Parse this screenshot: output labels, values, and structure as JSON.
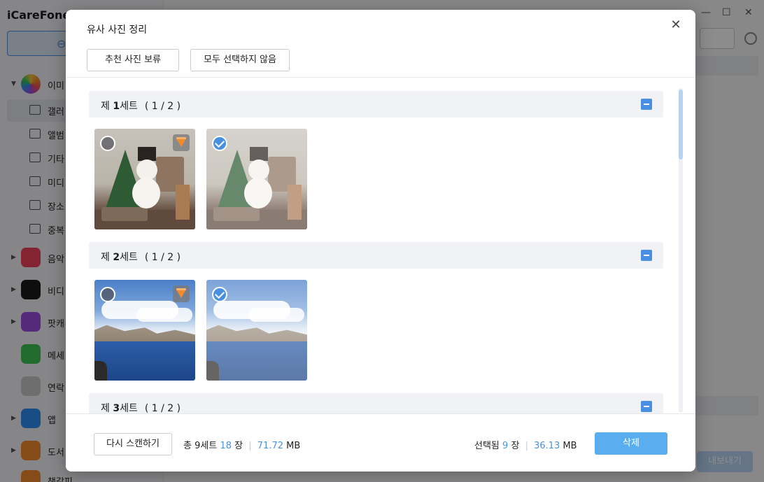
{
  "app": {
    "title": "iCareFone",
    "sidebar": {
      "groups": [
        {
          "label": "이미",
          "color": "#ffffff"
        },
        {
          "label": "음악",
          "color": "#f0405a"
        },
        {
          "label": "비디",
          "color": "#1b1b1b"
        },
        {
          "label": "팟캐",
          "color": "#9d4ee0"
        },
        {
          "label": "메세",
          "color": "#3cc455"
        },
        {
          "label": "연락",
          "color": "#c8c8c8"
        },
        {
          "label": "앱",
          "color": "#2f8cf3"
        },
        {
          "label": "도서",
          "color": "#f28a2e"
        },
        {
          "label": "책갈피",
          "color": "#f28a2e"
        }
      ],
      "subitems": [
        {
          "label": "갤러"
        },
        {
          "label": "앨범"
        },
        {
          "label": "기타"
        },
        {
          "label": "미디"
        },
        {
          "label": "장소"
        },
        {
          "label": "중복"
        }
      ]
    },
    "export_label": "내보내기"
  },
  "dialog": {
    "title": "유사 사진 정리",
    "buttons": {
      "keep_recommended": "추천 사진 보류",
      "deselect_all": "모두 선택하지 않음"
    },
    "sets": [
      {
        "prefix": "제 ",
        "number": "1",
        "suffix": "세트",
        "count": "( 1 / 2 )",
        "photos": [
          {
            "kind": "christmas",
            "selected": false,
            "recommended": true
          },
          {
            "kind": "christmas",
            "selected": true,
            "recommended": false
          }
        ]
      },
      {
        "prefix": "제 ",
        "number": "2",
        "suffix": "세트",
        "count": "( 1 / 2 )",
        "photos": [
          {
            "kind": "lake",
            "selected": false,
            "recommended": true
          },
          {
            "kind": "lake",
            "selected": true,
            "recommended": false
          }
        ]
      },
      {
        "prefix": "제 ",
        "number": "3",
        "suffix": "세트",
        "count": "( 1 / 2 )",
        "photos": []
      }
    ],
    "footer": {
      "rescan": "다시 스캔하기",
      "total_prefix": "총 9세트",
      "total_count": "18",
      "total_unit": "장",
      "total_size": "71.72",
      "total_size_unit": "MB",
      "selected_prefix": "선택됨",
      "selected_count": "9",
      "selected_unit": "장",
      "selected_size": "36.13",
      "selected_size_unit": "MB",
      "delete": "삭제"
    },
    "accent": "#4a90e2"
  }
}
